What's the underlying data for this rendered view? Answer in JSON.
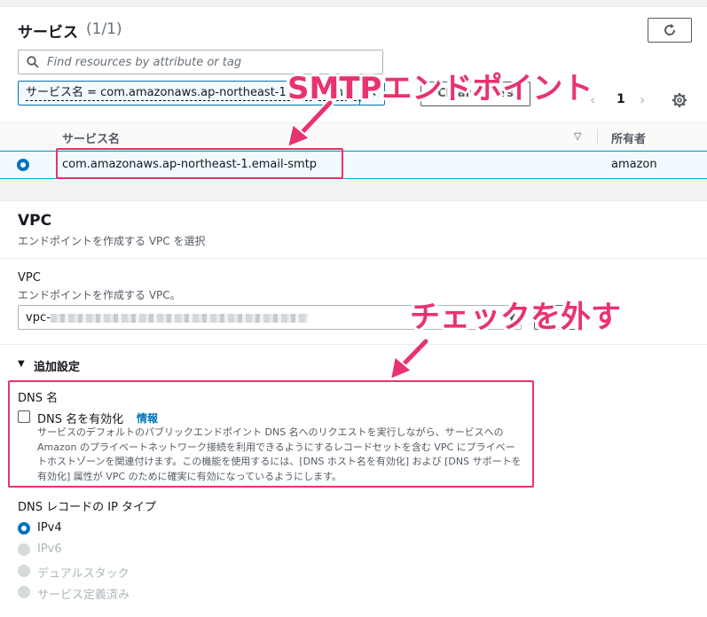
{
  "services": {
    "title": "サービス",
    "count": "(1/1)",
    "search_placeholder": "Find resources by attribute or tag",
    "filter_token": "サービス名 = com.amazonaws.ap-northeast-1.email-smtp",
    "filter_remove": "✕",
    "clear_filters": "Clear filters",
    "page_prev": "‹",
    "page_number": "1",
    "page_next": "›",
    "columns": {
      "name": "サービス名",
      "sort_icon": "▽",
      "owner": "所有者"
    },
    "rows": [
      {
        "name": "com.amazonaws.ap-northeast-1.email-smtp",
        "owner": "amazon",
        "selected": true
      }
    ]
  },
  "vpc_section": {
    "title": "VPC",
    "description": "エンドポイントを作成する VPC を選択",
    "field_label": "VPC",
    "field_description": "エンドポイントを作成する VPC。",
    "selected_value": "vpc-",
    "caret": "▼"
  },
  "additional_settings": {
    "toggle_icon": "▼",
    "label": "追加設定",
    "dns_name_label": "DNS 名",
    "enable_dns_label": "DNS 名を有効化",
    "enable_dns_checked": false,
    "info_link": "情報",
    "dns_description": "サービスのデフォルトのパブリックエンドポイント DNS 名へのリクエストを実行しながら、サービスへの Amazon のプライベートネットワーク接続を利用できるようにするレコードセットを含む VPC にプライベートホストゾーンを関連付けます。この機能を使用するには、[DNS ホスト名を有効化] および [DNS サポートを有効化] 属性が VPC のために確実に有効になっているようにします。",
    "ip_type_label": "DNS レコードの IP タイプ",
    "ip_options": [
      {
        "label": "IPv4",
        "selected": true,
        "enabled": true
      },
      {
        "label": "IPv6",
        "selected": false,
        "enabled": false
      },
      {
        "label": "デュアルスタック",
        "selected": false,
        "enabled": false
      },
      {
        "label": "サービス定義済み",
        "selected": false,
        "enabled": false
      }
    ]
  },
  "annotations": {
    "smtp_callout": "SMTPエンドポイント",
    "uncheck_callout": "チェックを外す",
    "accent_color": "#e8336e"
  },
  "colors": {
    "selection_blue": "#0073bb",
    "row_highlight": "#f1faff",
    "text_primary": "#16191f",
    "text_secondary": "#545b64"
  }
}
